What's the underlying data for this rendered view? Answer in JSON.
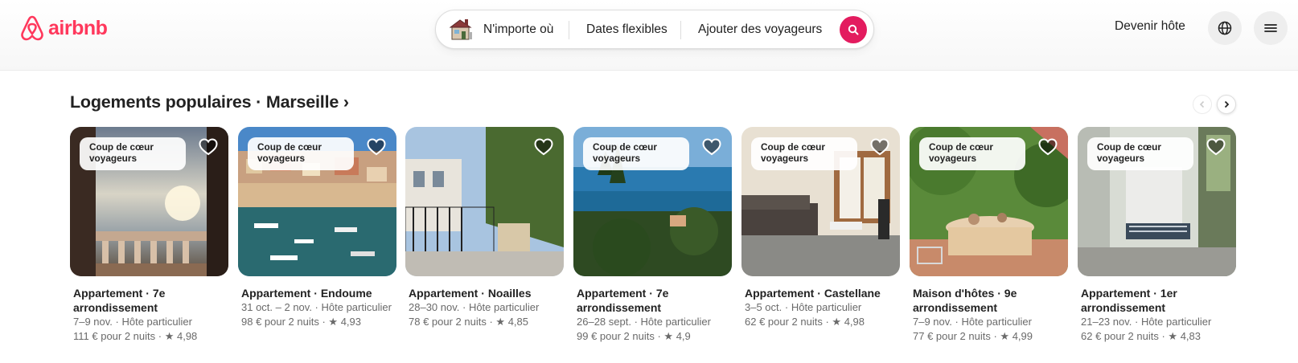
{
  "brand": {
    "name": "airbnb",
    "color": "#ff385c"
  },
  "search": {
    "where": "N'importe où",
    "dates": "Dates flexibles",
    "guests": "Ajouter des voyageurs",
    "button_icon": "search-icon",
    "accent": "#e31c5f"
  },
  "header": {
    "host_label": "Devenir hôte",
    "language_icon": "globe-icon",
    "menu_icon": "hamburger-menu-icon"
  },
  "section": {
    "title": "Logements populaires · Marseille ›"
  },
  "listings": [
    {
      "badge": "Coup de cœur voyageurs",
      "type": "Appartement",
      "location": "7e arrondissement",
      "dates": "7–9 nov.",
      "host": "Hôte particulier",
      "price": "111 € pour 2 nuits",
      "rating": "4,98"
    },
    {
      "badge": "Coup de cœur voyageurs",
      "type": "Appartement",
      "location": "Endoume",
      "dates": "31 oct. – 2 nov.",
      "host": "Hôte particulier",
      "price": "98 € pour 2 nuits",
      "rating": "4,93"
    },
    {
      "badge": "",
      "type": "Appartement",
      "location": "Noailles",
      "dates": "28–30 nov.",
      "host": "Hôte particulier",
      "price": "78 € pour 2 nuits",
      "rating": "4,85"
    },
    {
      "badge": "Coup de cœur voyageurs",
      "type": "Appartement",
      "location": "7e arrondissement",
      "dates": "26–28 sept.",
      "host": "Hôte particulier",
      "price": "99 € pour 2 nuits",
      "rating": "4,9"
    },
    {
      "badge": "Coup de cœur voyageurs",
      "type": "Appartement",
      "location": "Castellane",
      "dates": "3–5 oct.",
      "host": "Hôte particulier",
      "price": "62 € pour 2 nuits",
      "rating": "4,98"
    },
    {
      "badge": "Coup de cœur voyageurs",
      "type": "Maison d'hôtes",
      "location": "9e arrondissement",
      "dates": "7–9 nov.",
      "host": "Hôte particulier",
      "price": "77 € pour 2 nuits",
      "rating": "4,99"
    },
    {
      "badge": "Coup de cœur voyageurs",
      "type": "Appartement",
      "location": "1er arrondissement",
      "dates": "21–23 nov.",
      "host": "Hôte particulier",
      "price": "62 € pour 2 nuits",
      "rating": "4,83"
    }
  ]
}
